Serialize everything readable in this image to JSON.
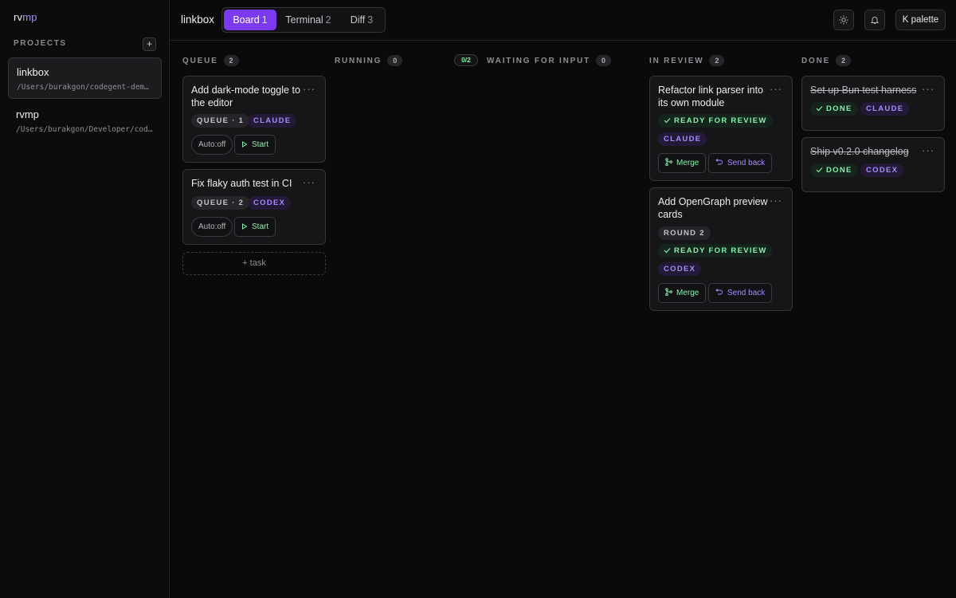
{
  "app": {
    "brand_part1": "rv",
    "brand_part2": "mp"
  },
  "sidebar": {
    "projects_heading": "PROJECTS",
    "add_label": "+",
    "projects": [
      {
        "name": "linkbox",
        "path": "/Users/burakgon/codegent-demo…",
        "active": true
      },
      {
        "name": "rvmp",
        "path": "/Users/burakgon/Developer/cod…",
        "active": false
      }
    ]
  },
  "header": {
    "project_title": "linkbox",
    "tabs": [
      {
        "label": "Board",
        "count": "1",
        "active": true
      },
      {
        "label": "Terminal",
        "count": "2",
        "active": false
      },
      {
        "label": "Diff",
        "count": "3",
        "active": false
      }
    ],
    "theme_icon": "sun-icon",
    "notifications_icon": "bell-icon",
    "palette_label": "K palette"
  },
  "board": {
    "columns": [
      {
        "title": "QUEUE",
        "count": "2"
      },
      {
        "title": "RUNNING",
        "count": "0"
      },
      {
        "title": "WAITING FOR INPUT",
        "count": "0",
        "ratio": "0/2"
      },
      {
        "title": "IN REVIEW",
        "count": "2"
      },
      {
        "title": "DONE",
        "count": "2"
      }
    ],
    "queue_cards": [
      {
        "title": "Add dark-mode toggle to the editor",
        "status": "QUEUE · 1",
        "agent": "CLAUDE",
        "auto": "Auto:off",
        "start": "Start"
      },
      {
        "title": "Fix flaky auth test in CI",
        "status": "QUEUE · 2",
        "agent": "CODEX",
        "auto": "Auto:off",
        "start": "Start"
      }
    ],
    "add_task_label": "+ task",
    "review_cards": [
      {
        "title": "Refactor link parser into its own module",
        "ready": "READY FOR REVIEW",
        "agent": "CLAUDE",
        "merge": "Merge",
        "send_back": "Send back"
      },
      {
        "title": "Add OpenGraph preview cards",
        "round": "ROUND 2",
        "ready": "READY FOR REVIEW",
        "agent": "CODEX",
        "merge": "Merge",
        "send_back": "Send back"
      }
    ],
    "done_cards": [
      {
        "title": "Set up Bun test harness",
        "status": "DONE",
        "agent": "CLAUDE"
      },
      {
        "title": "Ship v0.2.0 changelog",
        "status": "DONE",
        "agent": "CODEX"
      }
    ],
    "more_label": "···"
  },
  "colors": {
    "accent": "#7c3aed",
    "agent_purple": "#a78bfa",
    "success_green": "#86efac",
    "background": "#0a0a0b"
  }
}
